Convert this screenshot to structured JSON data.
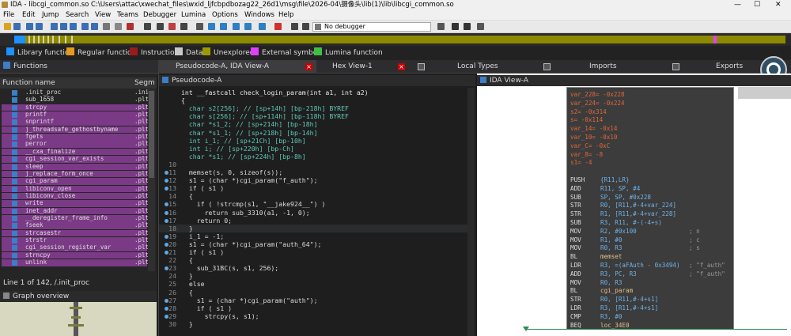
{
  "titlebar": {
    "title": "IDA - libcgi_common.so C:\\Users\\attac\\xwechat_files\\wxid_ljfcbpdbozag22_26d1\\msg\\file\\2026-04\\摄像头\\lib(1)\\lib\\libcgi_common.so",
    "min": "—",
    "max": "☐",
    "close": "✕"
  },
  "menu": [
    "File",
    "Edit",
    "Jump",
    "Search",
    "View",
    "Teams",
    "Debugger",
    "Lumina",
    "Options",
    "Windows",
    "Help"
  ],
  "toolbar": {
    "debugger": "No debugger"
  },
  "legend": [
    {
      "label": "Library function",
      "color": "#1e90ff"
    },
    {
      "label": "Regular function",
      "color": "#e89a1a"
    },
    {
      "label": "Instruction",
      "color": "#9b1b1b"
    },
    {
      "label": "Data",
      "color": "#c8c8c8"
    },
    {
      "label": "Unexplored",
      "color": "#9c9a00"
    },
    {
      "label": "External symbol",
      "color": "#e040fb"
    },
    {
      "label": "Lumina function",
      "color": "#40c040"
    }
  ],
  "tabs": {
    "functions": "Functions",
    "pseudocode": "Pseudocode-A, IDA View-A",
    "hex": "Hex View-1",
    "localtypes": "Local Types",
    "imports": "Imports",
    "exports": "Exports"
  },
  "functions": {
    "col_name": "Function name",
    "col_seg": "Segm",
    "rows": [
      {
        "name": ".init_proc",
        "seg": ".init",
        "lib": false
      },
      {
        "name": "sub_1658",
        "seg": ".plt",
        "lib": false
      },
      {
        "name": "strcpy",
        "seg": ".plt",
        "lib": true
      },
      {
        "name": "printf",
        "seg": ".plt",
        "lib": true
      },
      {
        "name": "snprintf",
        "seg": ".plt",
        "lib": true
      },
      {
        "name": "j_threadsafe_gethostbyname",
        "seg": ".plt",
        "lib": true
      },
      {
        "name": "fgets",
        "seg": ".plt",
        "lib": true
      },
      {
        "name": "perror",
        "seg": ".plt",
        "lib": true
      },
      {
        "name": "__cxa_finalize",
        "seg": ".plt",
        "lib": true
      },
      {
        "name": "cgi_session_var_exists",
        "seg": ".plt",
        "lib": true
      },
      {
        "name": "sleep",
        "seg": ".plt",
        "lib": true
      },
      {
        "name": "j_replace_form_once",
        "seg": ".plt",
        "lib": true
      },
      {
        "name": "cgi_param",
        "seg": ".plt",
        "lib": true
      },
      {
        "name": "libiconv_open",
        "seg": ".plt",
        "lib": true
      },
      {
        "name": "libiconv_close",
        "seg": ".plt",
        "lib": true
      },
      {
        "name": "write",
        "seg": ".plt",
        "lib": true
      },
      {
        "name": "inet_addr",
        "seg": ".plt",
        "lib": true
      },
      {
        "name": "__deregister_frame_info",
        "seg": ".plt",
        "lib": true
      },
      {
        "name": "fseek",
        "seg": ".plt",
        "lib": true
      },
      {
        "name": "strcasestr",
        "seg": ".plt",
        "lib": true
      },
      {
        "name": "strstr",
        "seg": ".plt",
        "lib": true
      },
      {
        "name": "cgi_session_register_var",
        "seg": ".plt",
        "lib": true
      },
      {
        "name": "strncpy",
        "seg": ".plt",
        "lib": true
      },
      {
        "name": "unlink",
        "seg": ".plt",
        "lib": true
      }
    ],
    "status": "Line 1 of 142, /.init_proc",
    "graph_overview": "Graph overview"
  },
  "pseudocode": {
    "header": "Pseudocode-A",
    "lines": [
      {
        "n": "",
        "t": "int __fastcall check_login_param(int a1, int a2)",
        "dot": false
      },
      {
        "n": "",
        "t": "{",
        "dot": false
      },
      {
        "n": "",
        "t": "  char s2[256]; // [sp+14h] [bp-218h] BYREF",
        "dot": false
      },
      {
        "n": "",
        "t": "  char s[256]; // [sp+114h] [bp-118h] BYREF",
        "dot": false
      },
      {
        "n": "",
        "t": "  char *s1_2; // [sp+214h] [bp-18h]",
        "dot": false
      },
      {
        "n": "",
        "t": "  char *s1_1; // [sp+218h] [bp-14h]",
        "dot": false
      },
      {
        "n": "",
        "t": "  int i_1; // [sp+21Ch] [bp-10h]",
        "dot": false
      },
      {
        "n": "",
        "t": "  int i; // [sp+220h] [bp-Ch]",
        "dot": false
      },
      {
        "n": "",
        "t": "  char *s1; // [sp+224h] [bp-8h]",
        "dot": false
      },
      {
        "n": "10",
        "t": "",
        "dot": false
      },
      {
        "n": "11",
        "t": "  memset(s, 0, sizeof(s));",
        "dot": true
      },
      {
        "n": "12",
        "t": "  s1 = (char *)cgi_param(\"f_auth\");",
        "dot": true
      },
      {
        "n": "13",
        "t": "  if ( s1 )",
        "dot": true
      },
      {
        "n": "14",
        "t": "  {",
        "dot": false
      },
      {
        "n": "15",
        "t": "    if ( !strcmp(s1, \"__jake924__\") )",
        "dot": true
      },
      {
        "n": "16",
        "t": "      return sub_3310(a1, -1, 0);",
        "dot": true
      },
      {
        "n": "17",
        "t": "    return 0;",
        "dot": true
      },
      {
        "n": "18",
        "t": "  }",
        "dot": false
      },
      {
        "n": "19",
        "t": "  i_1 = -1;",
        "dot": true
      },
      {
        "n": "20",
        "t": "  s1 = (char *)cgi_param(\"auth_64\");",
        "dot": true
      },
      {
        "n": "21",
        "t": "  if ( s1 )",
        "dot": true
      },
      {
        "n": "22",
        "t": "  {",
        "dot": false
      },
      {
        "n": "23",
        "t": "    sub_31BC(s, s1, 256);",
        "dot": true
      },
      {
        "n": "24",
        "t": "  }",
        "dot": false
      },
      {
        "n": "25",
        "t": "  else",
        "dot": false
      },
      {
        "n": "26",
        "t": "  {",
        "dot": false
      },
      {
        "n": "27",
        "t": "    s1 = (char *)cgi_param(\"auth\");",
        "dot": true
      },
      {
        "n": "28",
        "t": "    if ( s1 )",
        "dot": true
      },
      {
        "n": "29",
        "t": "      strcpy(s, s1);",
        "dot": true
      },
      {
        "n": "30",
        "t": "  }",
        "dot": false
      }
    ]
  },
  "idaview": {
    "header": "IDA View-A",
    "lines": [
      {
        "m": "",
        "o": "var_228= -0x228",
        "c": "",
        "var": true
      },
      {
        "m": "",
        "o": "var_224= -0x224",
        "c": "",
        "var": true
      },
      {
        "m": "",
        "o": "s2= -0x314",
        "c": "",
        "var": true
      },
      {
        "m": "",
        "o": "s= -0x114",
        "c": "",
        "var": true
      },
      {
        "m": "",
        "o": "var_14= -0x14",
        "c": "",
        "var": true
      },
      {
        "m": "",
        "o": "var_10= -0x10",
        "c": "",
        "var": true
      },
      {
        "m": "",
        "o": "var_C= -0xC",
        "c": "",
        "var": true
      },
      {
        "m": "",
        "o": "var_8= -8",
        "c": "",
        "var": true
      },
      {
        "m": "",
        "o": "s1= -4",
        "c": "",
        "var": true
      },
      {
        "m": "",
        "o": "",
        "c": "",
        "var": true
      },
      {
        "m": "PUSH",
        "o": "{R11,LR}",
        "c": "",
        "var": false
      },
      {
        "m": "ADD",
        "o": "R11, SP, #4",
        "c": "",
        "var": false
      },
      {
        "m": "SUB",
        "o": "SP, SP, #0x228",
        "c": "",
        "var": false
      },
      {
        "m": "STR",
        "o": "R0, [R11,#-4+var_224]",
        "c": "",
        "var": false
      },
      {
        "m": "STR",
        "o": "R1, [R11,#-4+var_228]",
        "c": "",
        "var": false
      },
      {
        "m": "SUB",
        "o": "R3, R11, #-(-4+s)",
        "c": "",
        "var": false
      },
      {
        "m": "MOV",
        "o": "R2, #0x100",
        "c": "; n",
        "var": false
      },
      {
        "m": "MOV",
        "o": "R1, #0",
        "c": "; c",
        "var": false
      },
      {
        "m": "MOV",
        "o": "R0, R3",
        "c": "; s",
        "var": false
      },
      {
        "m": "BL",
        "o": "memset",
        "c": "",
        "var": false
      },
      {
        "m": "LDR",
        "o": "R3, =(aFAuth - 0x3494)",
        "c": "; \"f_auth\"",
        "var": false
      },
      {
        "m": "ADD",
        "o": "R3, PC, R3",
        "c": "; \"f_auth\"",
        "var": false
      },
      {
        "m": "MOV",
        "o": "R0, R3",
        "c": "",
        "var": false
      },
      {
        "m": "BL",
        "o": "cgi_param",
        "c": "",
        "var": false
      },
      {
        "m": "STR",
        "o": "R0, [R11,#-4+s1]",
        "c": "",
        "var": false
      },
      {
        "m": "LDR",
        "o": "R3, [R11,#-4+s1]",
        "c": "",
        "var": false
      },
      {
        "m": "CMP",
        "o": "R3, #0",
        "c": "",
        "var": false
      },
      {
        "m": "BEQ",
        "o": "loc_34E0",
        "c": "",
        "var": false
      }
    ]
  },
  "colors": {
    "library_fn_bg": "#7b3a86",
    "code_keyword": "#dcdcdc",
    "asm_var": "#e0673a",
    "asm_operand": "#6fb3e8",
    "asm_label": "#e2c08d"
  }
}
